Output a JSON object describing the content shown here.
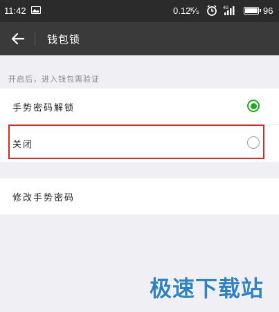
{
  "status_bar": {
    "time": "11:42",
    "network_speed": "0.12ᴷ⁄ₛ",
    "battery": "96",
    "icons": [
      "image-icon",
      "alarm-icon",
      "signal-icon",
      "battery-icon"
    ]
  },
  "header": {
    "title": "钱包锁",
    "back_icon": "back-arrow-icon"
  },
  "hint": "开启后，进入钱包需验证",
  "options": [
    {
      "label": "手势密码解锁",
      "selected": true
    },
    {
      "label": "关闭",
      "selected": false
    }
  ],
  "modify": {
    "label": "修改手势密码"
  },
  "watermark": "极速下载站",
  "colors": {
    "accent_green": "#1aad19",
    "highlight_red": "#e02424",
    "header_bg": "#3a3a3a",
    "status_bg": "#2b2b2b",
    "page_bg": "#efeff4",
    "watermark_blue": "#2f82c8"
  }
}
